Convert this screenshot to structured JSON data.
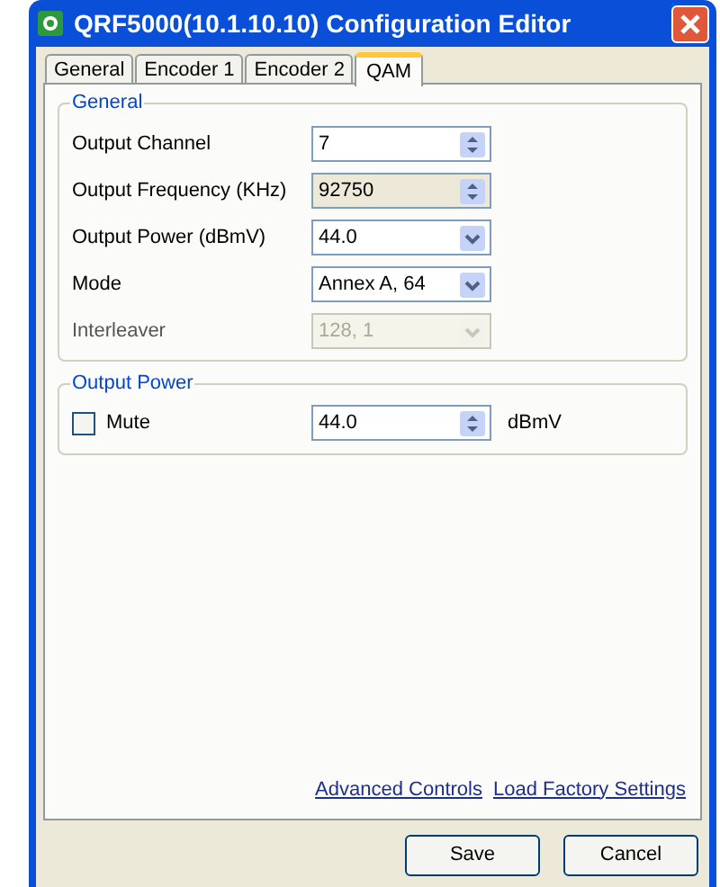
{
  "window": {
    "title": "QRF5000(10.1.10.10) Configuration Editor"
  },
  "tabs": [
    {
      "label": "General",
      "selected": false
    },
    {
      "label": "Encoder 1",
      "selected": false
    },
    {
      "label": "Encoder 2",
      "selected": false
    },
    {
      "label": "QAM",
      "selected": true
    }
  ],
  "general_group": {
    "title": "General",
    "fields": [
      {
        "label": "Output Channel",
        "kind": "spinner",
        "value": "7",
        "readonly": false,
        "disabled": false
      },
      {
        "label": "Output Frequency (KHz)",
        "kind": "spinner",
        "value": "92750",
        "readonly": true,
        "disabled": false
      },
      {
        "label": "Output Power (dBmV)",
        "kind": "combo",
        "value": "44.0",
        "readonly": false,
        "disabled": false
      },
      {
        "label": "Mode",
        "kind": "combo",
        "value": "Annex A, 64",
        "readonly": false,
        "disabled": false
      },
      {
        "label": "Interleaver",
        "kind": "combo",
        "value": "128, 1",
        "readonly": false,
        "disabled": true
      }
    ]
  },
  "output_power_group": {
    "title": "Output Power",
    "mute": {
      "label": "Mute",
      "checked": false
    },
    "value": "44.0",
    "unit": "dBmV"
  },
  "links": [
    "Advanced Controls",
    "Load Factory Settings"
  ],
  "buttons": [
    "Save",
    "Cancel"
  ]
}
